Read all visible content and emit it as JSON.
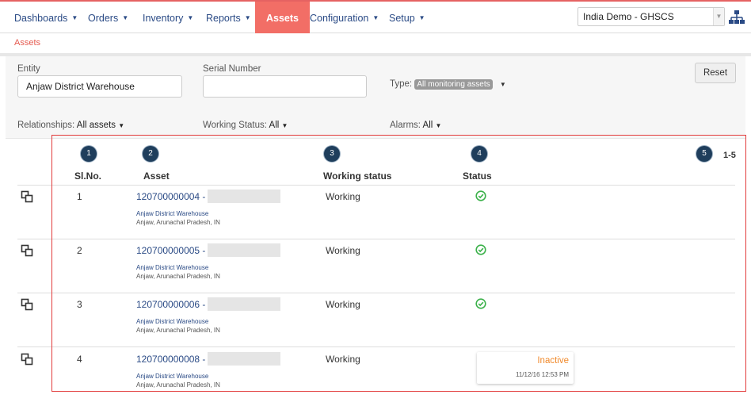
{
  "nav": {
    "items": [
      {
        "label": "Dashboards",
        "caret": true
      },
      {
        "label": "Orders",
        "caret": true
      },
      {
        "label": "Inventory",
        "caret": true
      },
      {
        "label": "Reports",
        "caret": true
      },
      {
        "label": "Assets",
        "caret": false,
        "active": true
      },
      {
        "label": "Configuration",
        "caret": true
      },
      {
        "label": "Setup",
        "caret": true
      }
    ],
    "tenant": "India Demo - GHSCS",
    "org_icon": "org-chart-icon"
  },
  "breadcrumb": "Assets",
  "filters": {
    "entity_label": "Entity",
    "entity_value": "Anjaw District Warehouse",
    "serial_label": "Serial Number",
    "serial_value": "",
    "type_label": "Type:",
    "type_value": "All monitoring assets",
    "reset_label": "Reset",
    "relationships_label": "Relationships:",
    "relationships_value": "All assets",
    "working_label": "Working Status:",
    "working_value": "All",
    "alarms_label": "Alarms:",
    "alarms_value": "All"
  },
  "table": {
    "markers": [
      "1",
      "2",
      "3",
      "4",
      "5"
    ],
    "headers": {
      "slno": "Sl.No.",
      "asset": "Asset",
      "working": "Working status",
      "status": "Status"
    },
    "range": "1-5",
    "rows": [
      {
        "slno": "1",
        "asset": "120700000004 - F",
        "entity": "Anjaw District Warehouse",
        "location": "Anjaw, Arunachal Pradesh, IN",
        "working": "Working",
        "status": "ok"
      },
      {
        "slno": "2",
        "asset": "120700000005 - F",
        "entity": "Anjaw District Warehouse",
        "location": "Anjaw, Arunachal Pradesh, IN",
        "working": "Working",
        "status": "ok"
      },
      {
        "slno": "3",
        "asset": "120700000006 - F",
        "entity": "Anjaw District Warehouse",
        "location": "Anjaw, Arunachal Pradesh, IN",
        "working": "Working",
        "status": "ok"
      },
      {
        "slno": "4",
        "asset": "120700000008 - F",
        "entity": "Anjaw District Warehouse",
        "location": "Anjaw, Arunachal Pradesh, IN",
        "working": "Working",
        "status": "inactive",
        "status_text": "Inactive",
        "status_time": "11/12/16 12:53 PM"
      }
    ]
  },
  "colors": {
    "accent": "#f26e66",
    "link": "#2a4a85",
    "ok": "#3bb14a",
    "inactive": "#f08a2c",
    "annotation": "#e23a3a"
  }
}
